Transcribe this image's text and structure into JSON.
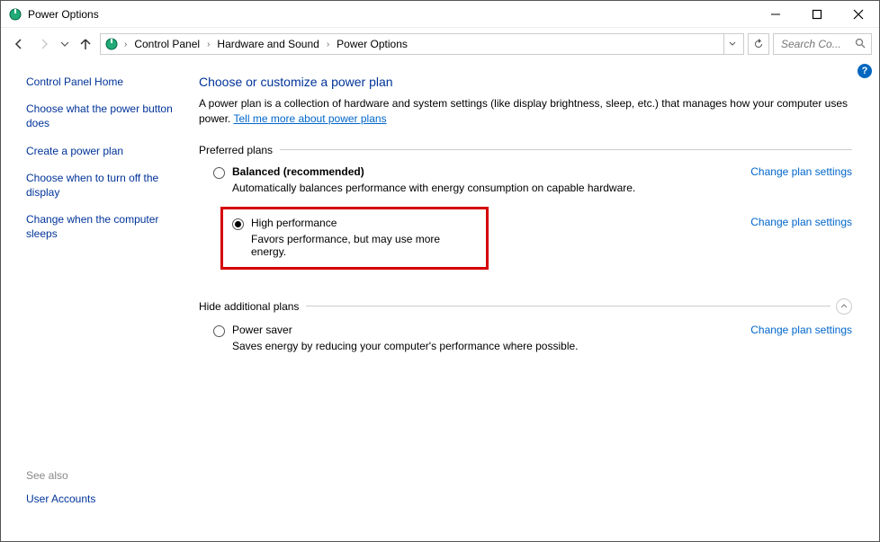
{
  "window": {
    "title": "Power Options"
  },
  "breadcrumb": {
    "items": [
      "Control Panel",
      "Hardware and Sound",
      "Power Options"
    ]
  },
  "search": {
    "placeholder": "Search Co..."
  },
  "sidebar": {
    "home": "Control Panel Home",
    "links": [
      "Choose what the power button does",
      "Create a power plan",
      "Choose when to turn off the display",
      "Change when the computer sleeps"
    ],
    "see_also_label": "See also",
    "see_also_link": "User Accounts"
  },
  "main": {
    "heading": "Choose or customize a power plan",
    "intro": "A power plan is a collection of hardware and system settings (like display brightness, sleep, etc.) that manages how your computer uses power. ",
    "intro_link": "Tell me more about power plans",
    "preferred_label": "Preferred plans",
    "additional_label": "Hide additional plans",
    "change_link": "Change plan settings",
    "plans": {
      "balanced": {
        "name": "Balanced (recommended)",
        "desc": "Automatically balances performance with energy consumption on capable hardware."
      },
      "high_perf": {
        "name": "High performance",
        "desc": "Favors performance, but may use more energy."
      },
      "power_saver": {
        "name": "Power saver",
        "desc": "Saves energy by reducing your computer's performance where possible."
      }
    }
  }
}
